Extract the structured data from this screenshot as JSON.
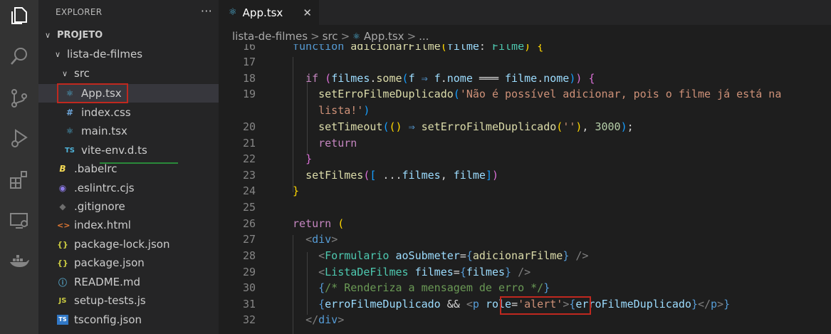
{
  "activity_bar": {
    "icons": [
      "explorer-icon",
      "search-icon",
      "source-control-icon",
      "run-debug-icon",
      "extensions-icon",
      "remote-explorer-icon",
      "docker-icon"
    ]
  },
  "sidebar": {
    "title": "EXPLORER",
    "more_label": "···",
    "tree": [
      {
        "label": "PROJETO",
        "chevron": "∨",
        "icon": ""
      },
      {
        "label": "lista-de-filmes",
        "chevron": "∨",
        "icon": ""
      },
      {
        "label": "src",
        "chevron": "∨",
        "icon": ""
      },
      {
        "label": "App.tsx",
        "chevron": "",
        "icon": "⚛"
      },
      {
        "label": "index.css",
        "chevron": "",
        "icon": "#"
      },
      {
        "label": "main.tsx",
        "chevron": "",
        "icon": "⚛"
      },
      {
        "label": "vite-env.d.ts",
        "chevron": "",
        "icon": "TS"
      },
      {
        "label": ".babelrc",
        "chevron": "",
        "icon": "B"
      },
      {
        "label": ".eslintrc.cjs",
        "chevron": "",
        "icon": "◉"
      },
      {
        "label": ".gitignore",
        "chevron": "",
        "icon": "◆"
      },
      {
        "label": "index.html",
        "chevron": "",
        "icon": "<>"
      },
      {
        "label": "package-lock.json",
        "chevron": "",
        "icon": "{}"
      },
      {
        "label": "package.json",
        "chevron": "",
        "icon": "{}"
      },
      {
        "label": "README.md",
        "chevron": "",
        "icon": "ⓘ"
      },
      {
        "label": "setup-tests.js",
        "chevron": "",
        "icon": "JS"
      },
      {
        "label": "tsconfig.json",
        "chevron": "",
        "icon": "TS"
      }
    ]
  },
  "editor": {
    "tab": {
      "label": "App.tsx",
      "icon": "⚛",
      "close": "✕"
    },
    "breadcrumb": [
      "lista-de-filmes",
      "src",
      "App.tsx",
      "..."
    ],
    "breadcrumb_sep": ">",
    "line_numbers": [
      "16",
      "17",
      "18",
      "19",
      "",
      "20",
      "21",
      "22",
      "23",
      "24",
      "25",
      "26",
      "27",
      "28",
      "29",
      "30",
      "31",
      "32"
    ],
    "colors": {
      "keyword": "#c586c0",
      "function": "#dcdcaa",
      "string": "#ce9178",
      "variable": "#9cdcfe",
      "highlight": "#c0281f"
    }
  }
}
